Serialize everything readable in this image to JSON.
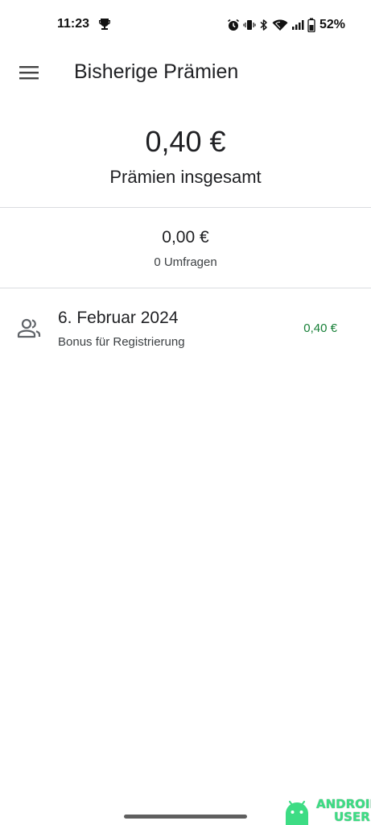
{
  "status_bar": {
    "time": "11:23",
    "battery": "52%",
    "icons": [
      "trophy-icon",
      "alarm-icon",
      "vibrate-icon",
      "bluetooth-icon",
      "wifi-icon",
      "signal-icon",
      "battery-icon"
    ]
  },
  "app_bar": {
    "title": "Bisherige Prämien",
    "menu_icon": "menu-icon"
  },
  "summary": {
    "total_amount": "0,40 €",
    "total_label": "Prämien insgesamt",
    "survey_amount": "0,00 €",
    "survey_count": "0 Umfragen"
  },
  "rewards": [
    {
      "icon": "people-icon",
      "date": "6. Februar 2024",
      "description": "Bonus für Registrierung",
      "amount": "0,40 €"
    }
  ],
  "watermark": {
    "line1": "ANDROID",
    "line2": "USER"
  },
  "colors": {
    "accent_green": "#188038",
    "divider": "#dadce0",
    "text_primary": "#202124",
    "text_secondary": "#3c4043",
    "watermark_green": "#3ddc84"
  }
}
